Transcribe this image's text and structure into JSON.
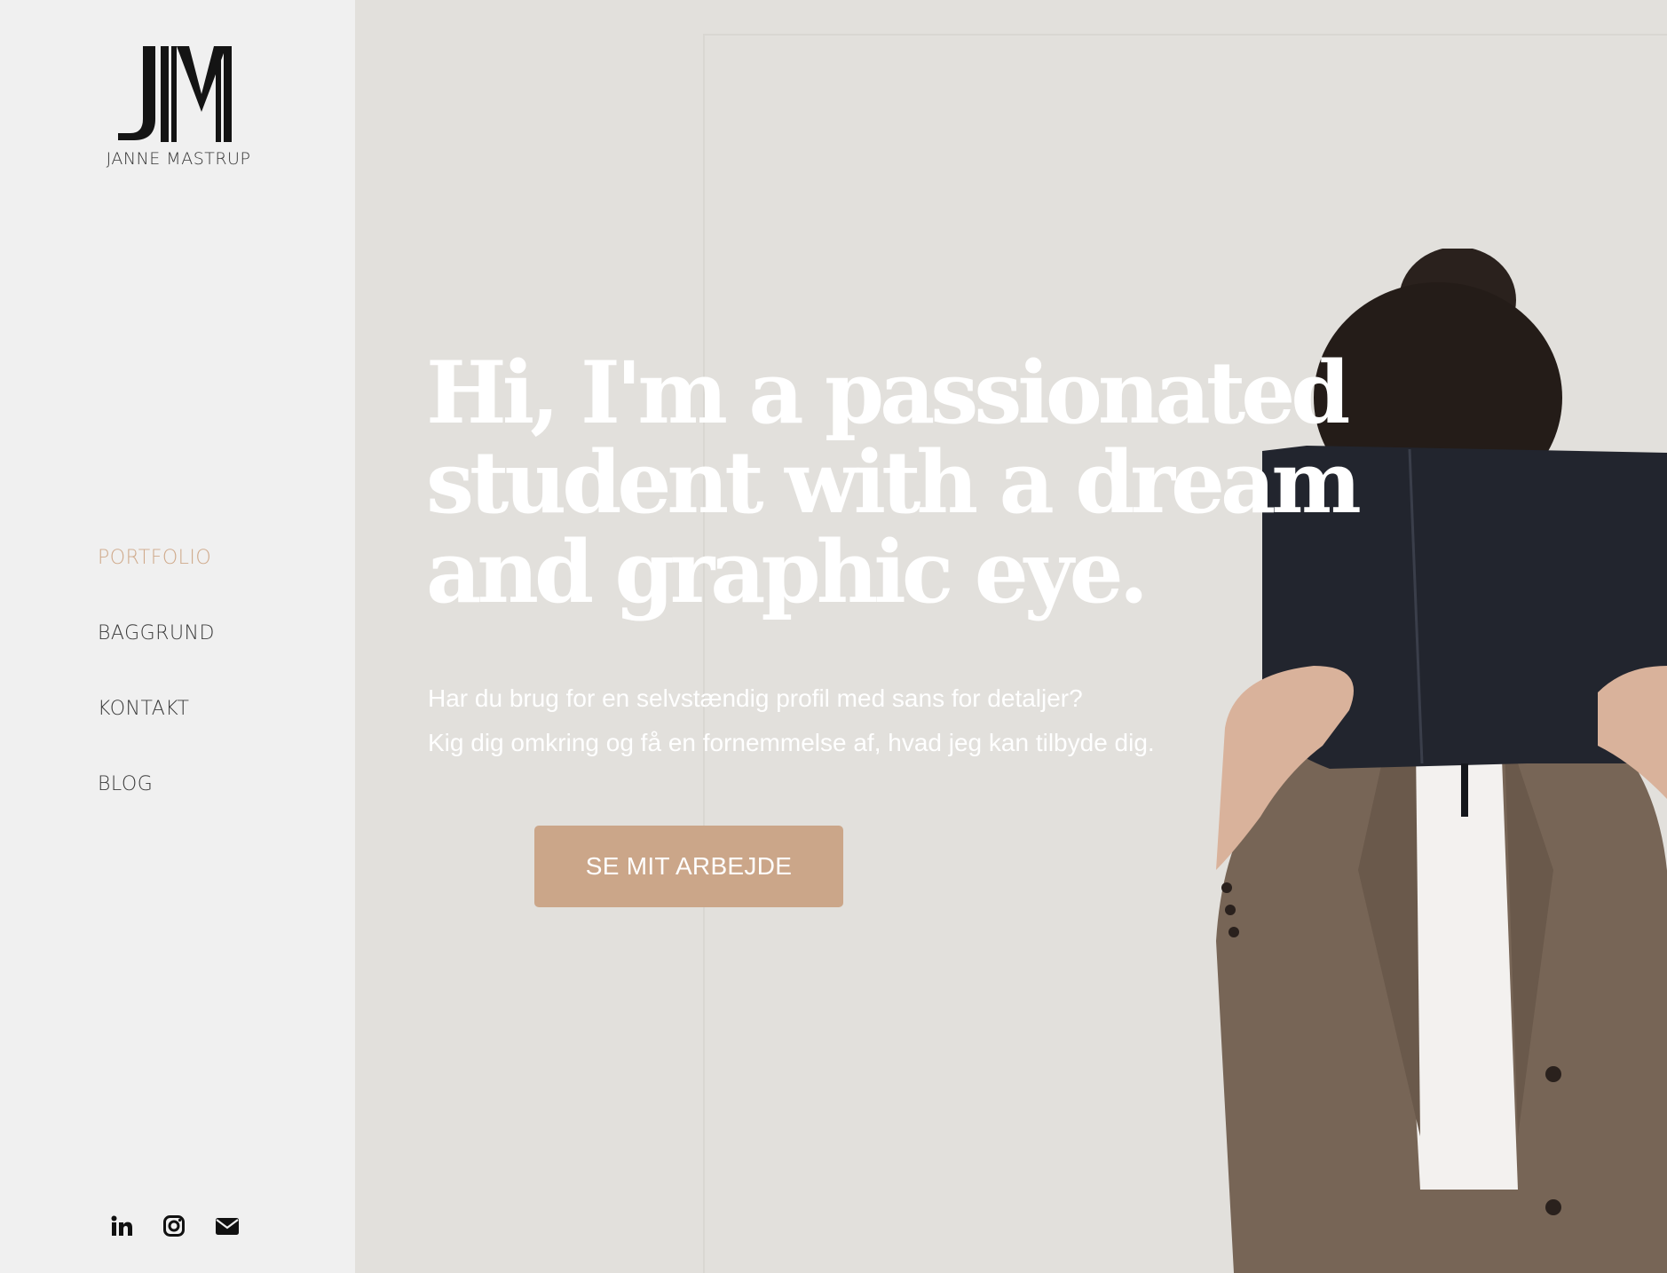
{
  "brand": {
    "monogram": "JM",
    "name": "JANNE MASTRUP"
  },
  "nav": {
    "items": [
      {
        "label": "PORTFOLIO",
        "active": true
      },
      {
        "label": "BAGGRUND",
        "active": false
      },
      {
        "label": "KONTAKT",
        "active": false
      },
      {
        "label": "BLOG",
        "active": false
      }
    ]
  },
  "social": {
    "icons": [
      "linkedin-icon",
      "instagram-icon",
      "mail-icon"
    ]
  },
  "hero": {
    "headline": "Hi, I'm a passionated student with a dream and graphic eye.",
    "sub_line_1": "Har du brug for en selvstændig profil med sans for detaljer?",
    "sub_line_2": "Kig dig omkring og få en fornemmelse af, hvad jeg kan tilbyde dig.",
    "cta_label": "SE MIT ARBEJDE"
  },
  "colors": {
    "accent": "#cba689",
    "sidebar_bg": "#f0f0f0",
    "hero_bg": "#e2e0dc",
    "active_nav": "#cfa98a"
  }
}
